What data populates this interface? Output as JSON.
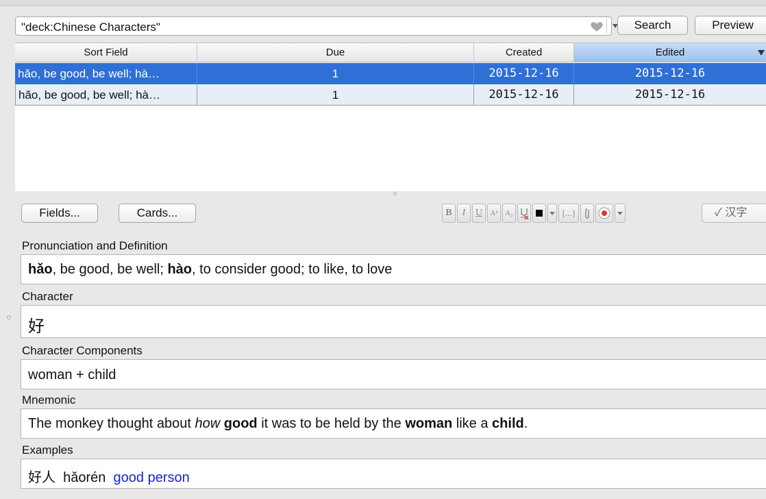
{
  "search": {
    "query": "\"deck:Chinese Characters\"",
    "search_label": "Search",
    "preview_label": "Preview",
    "icons": [
      "heart-icon",
      "chevron-down-icon"
    ]
  },
  "table": {
    "columns": [
      "Sort Field",
      "Due",
      "Created",
      "Edited"
    ],
    "sorted_column": "Edited",
    "rows": [
      {
        "sort_field": "hǎo, be good, be well; hà…",
        "due": "1",
        "created": "2015-12-16",
        "edited": "2015-12-16",
        "selected": true
      },
      {
        "sort_field": "hǎo, be good, be well; hà…",
        "due": "1",
        "created": "2015-12-16",
        "edited": "2015-12-16",
        "selected": false
      }
    ]
  },
  "editor": {
    "fields_button": "Fields...",
    "cards_button": "Cards...",
    "format_buttons": [
      "B",
      "I",
      "U",
      "A²",
      "A₂"
    ],
    "cloze_label": "[...]",
    "hanzi_button": "✓ 汉字",
    "icons": [
      "bold-icon",
      "italic-icon",
      "underline-icon",
      "superscript-icon",
      "subscript-icon",
      "clear-format-icon",
      "text-color-icon",
      "chevron-down-icon",
      "cloze-icon",
      "attachment-icon",
      "record-icon",
      "chevron-down-icon"
    ]
  },
  "fields": [
    {
      "label": "Pronunciation and Definition",
      "parts": [
        {
          "text": "hǎo",
          "style": "bold"
        },
        {
          "text": ", be good, be well; ",
          "style": ""
        },
        {
          "text": "hào",
          "style": "bold"
        },
        {
          "text": ", to consider good; to like, to love",
          "style": ""
        }
      ]
    },
    {
      "label": "Character",
      "parts": [
        {
          "text": "好",
          "style": ""
        }
      ]
    },
    {
      "label": "Character Components",
      "parts": [
        {
          "text": "woman + child",
          "style": ""
        }
      ]
    },
    {
      "label": "Mnemonic",
      "parts": [
        {
          "text": "The monkey thought about ",
          "style": ""
        },
        {
          "text": "how",
          "style": "italic"
        },
        {
          "text": " ",
          "style": ""
        },
        {
          "text": "good",
          "style": "bold"
        },
        {
          "text": " it was to be held by the ",
          "style": ""
        },
        {
          "text": "woman",
          "style": "bold"
        },
        {
          "text": " like a ",
          "style": ""
        },
        {
          "text": "child",
          "style": "bold"
        },
        {
          "text": ".",
          "style": ""
        }
      ]
    },
    {
      "label": "Examples",
      "parts": [
        {
          "text": "好人  hǎorén  ",
          "style": ""
        },
        {
          "text": "good person",
          "style": "blue"
        }
      ]
    }
  ],
  "colors": {
    "selection": "#2f6fd6",
    "sorted_header": "#9cc0f0",
    "link_blue": "#1a22d8"
  }
}
